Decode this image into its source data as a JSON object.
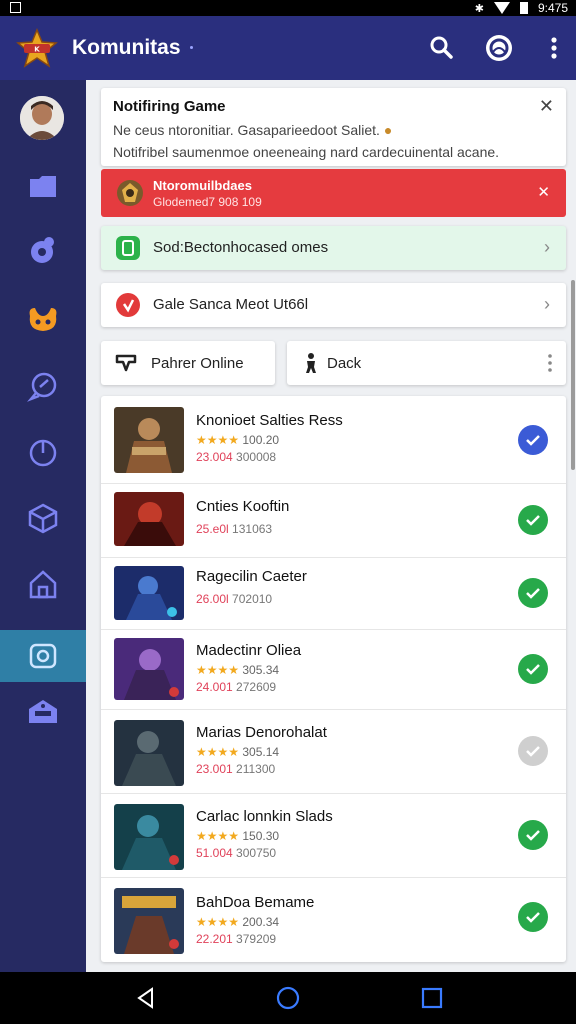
{
  "status_bar": {
    "time": "9:475",
    "bluetooth_icon": "bluetooth-icon",
    "wifi_icon": "wifi-icon",
    "battery_icon": "battery-icon"
  },
  "app_bar": {
    "title": "Komunitas",
    "brand_color": "#2a2f7e",
    "actions": [
      "search-icon",
      "account-icon",
      "more-vert-icon"
    ]
  },
  "sidebar": {
    "background": "#262a62",
    "active_color": "#2f7fa6",
    "items": [
      {
        "icon": "folder-icon"
      },
      {
        "icon": "controller-icon"
      },
      {
        "icon": "paw-icon"
      },
      {
        "icon": "chat-icon"
      },
      {
        "icon": "power-icon"
      },
      {
        "icon": "cube-icon"
      },
      {
        "icon": "home-icon"
      },
      {
        "icon": "camera-icon",
        "active": true
      },
      {
        "icon": "store-icon"
      }
    ]
  },
  "notification": {
    "title": "Notifiring Game",
    "line1": "Ne ceus ntoronitiar. Gasaparieedoot Saliet.",
    "line2": "Notifribel saumenmoe oneeneaing nard cardecuinental acane."
  },
  "alert": {
    "title": "Ntoromuilbdaes",
    "subtitle": "Glodemed7 908 109",
    "color": "#e53b3f"
  },
  "rows": [
    {
      "label": "Sod:Bectonhocased omes",
      "icon": "phone-icon",
      "style": "green"
    },
    {
      "label": "Gale Sanca Meot Ut66l",
      "icon": "flash-icon",
      "style": "white"
    }
  ],
  "pills": [
    {
      "label": "Pahrer Online",
      "icon": "controller-outline-icon"
    },
    {
      "label": "Dack",
      "icon": "person-icon"
    }
  ],
  "games": [
    {
      "title": "Knonioet Salties Ress",
      "stars": "★★★★",
      "rating": "100.20",
      "stats_a": "23.004",
      "stats_b": "300008",
      "check": "blue"
    },
    {
      "title": "Cnties Kooftin",
      "stars": "",
      "rating": "",
      "stats_a": "25.e0l",
      "stats_b": "131063",
      "check": "green"
    },
    {
      "title": "Ragecilin Caeter",
      "stars": "",
      "rating": "",
      "stats_a": "26.00l",
      "stats_b": "702010",
      "check": "green"
    },
    {
      "title": "Madectinr Oliea",
      "stars": "★★★★",
      "rating": "305.34",
      "stats_a": "24.001",
      "stats_b": "272609",
      "check": "green"
    },
    {
      "title": "Marias Denorohalat",
      "stars": "★★★★",
      "rating": "305.14",
      "stats_a": "23.001",
      "stats_b": "211300",
      "check": "gray"
    },
    {
      "title": "Carlac lonnkin Slads",
      "stars": "★★★★",
      "rating": "150.30",
      "stats_a": "51.004",
      "stats_b": "300750",
      "check": "green"
    },
    {
      "title": "BahDoa Bemame",
      "stars": "★★★★",
      "rating": "200.34",
      "stats_a": "22.201",
      "stats_b": "379209",
      "check": "green"
    }
  ],
  "check_colors": {
    "blue": "#3b5bd6",
    "green": "#27a94a",
    "gray": "#cfcfcf"
  },
  "nav_bar": [
    "back-icon",
    "home-circle-icon",
    "recents-icon"
  ]
}
